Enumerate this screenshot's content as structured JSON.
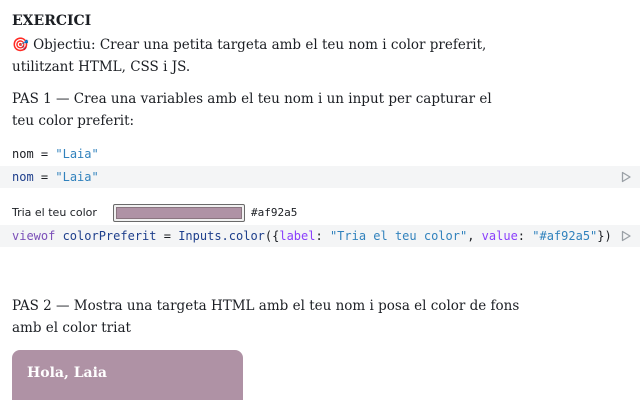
{
  "notebook": {
    "title": "EXERCICI",
    "objective": "🎯 Objectiu: Crear una petita targeta amb el teu nom i color preferit, utilitzant HTML, CSS i JS.",
    "step1": "PAS 1 — Crea una variables amb el teu nom i un input per capturar el teu color preferit:",
    "step2": "PAS 2 — Mostra una targeta HTML amb el teu nom i posa el color de fons amb el color triat"
  },
  "cells": {
    "nom_output": {
      "name": "nom",
      "op": " = ",
      "value": "\"Laia\""
    },
    "nom_code": {
      "name": "nom",
      "op": " = ",
      "value": "\"Laia\""
    },
    "color_code": {
      "keyword": "viewof",
      "name": " colorPreferit",
      "op": " = ",
      "fn": "Inputs.color",
      "open": "({",
      "label_key": "label",
      "colon1": ": ",
      "label_val": "\"Tria el teu color\"",
      "comma": ", ",
      "value_key": "value",
      "colon2": ": ",
      "value_val": "\"#af92a5\"",
      "close": "})"
    }
  },
  "color_input": {
    "label": "Tria el teu color",
    "value": "#af92a5",
    "color": "#af92a5"
  },
  "card": {
    "text": "Hola, Laia",
    "background": "#af92a5"
  },
  "icons": {
    "run": "play-icon"
  }
}
